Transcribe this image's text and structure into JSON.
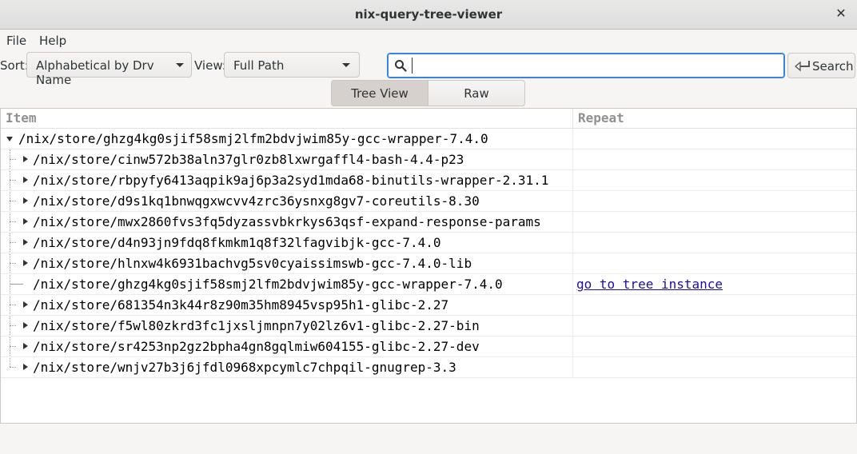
{
  "window": {
    "title": "nix-query-tree-viewer",
    "close_glyph": "✕"
  },
  "menu": {
    "file": "File",
    "help": "Help"
  },
  "toolbar": {
    "sort_label": "Sort:",
    "sort_value": "Alphabetical by Drv Name",
    "view_label": "View:",
    "view_value": "Full Path",
    "search_placeholder": "",
    "search_button": "Search"
  },
  "tabs": {
    "tree_view": "Tree View",
    "raw": "Raw"
  },
  "tree": {
    "headers": {
      "item": "Item",
      "repeat": "Repeat"
    },
    "root": "/nix/store/ghzg4kg0sjif58smj2lfm2bdvjwim85y-gcc-wrapper-7.4.0",
    "children": [
      {
        "path": "/nix/store/cinw572b38aln37glr0zb8lxwrgaffl4-bash-4.4-p23",
        "repeat": ""
      },
      {
        "path": "/nix/store/rbpyfy6413aqpik9aj6p3a2syd1mda68-binutils-wrapper-2.31.1",
        "repeat": ""
      },
      {
        "path": "/nix/store/d9s1kq1bnwqgxwcvv4zrc36ysnxg8gv7-coreutils-8.30",
        "repeat": ""
      },
      {
        "path": "/nix/store/mwx2860fvs3fq5dyzassvbkrkys63qsf-expand-response-params",
        "repeat": ""
      },
      {
        "path": "/nix/store/d4n93jn9fdq8fkmkm1q8f32lfagvibjk-gcc-7.4.0",
        "repeat": ""
      },
      {
        "path": "/nix/store/hlnxw4k6931bachvg5sv0cyaissimswb-gcc-7.4.0-lib",
        "repeat": ""
      },
      {
        "path": "/nix/store/ghzg4kg0sjif58smj2lfm2bdvjwim85y-gcc-wrapper-7.4.0",
        "repeat": "go to tree instance"
      },
      {
        "path": "/nix/store/681354n3k44r8z90m35hm8945vsp95h1-glibc-2.27",
        "repeat": ""
      },
      {
        "path": "/nix/store/f5wl80zkrd3fc1jxsljmnpn7y02lz6v1-glibc-2.27-bin",
        "repeat": ""
      },
      {
        "path": "/nix/store/sr4253np2gz2bpha4gn8gqlmiw604155-glibc-2.27-dev",
        "repeat": ""
      },
      {
        "path": "/nix/store/wnjv27b3j6jfdl0968xpcymlc7chpqil-gnugrep-3.3",
        "repeat": ""
      }
    ]
  },
  "icons": {
    "search": "search-icon",
    "search_button": "enter-arrow-icon",
    "expand": "triangle-right-icon",
    "collapse": "triangle-down-icon"
  }
}
